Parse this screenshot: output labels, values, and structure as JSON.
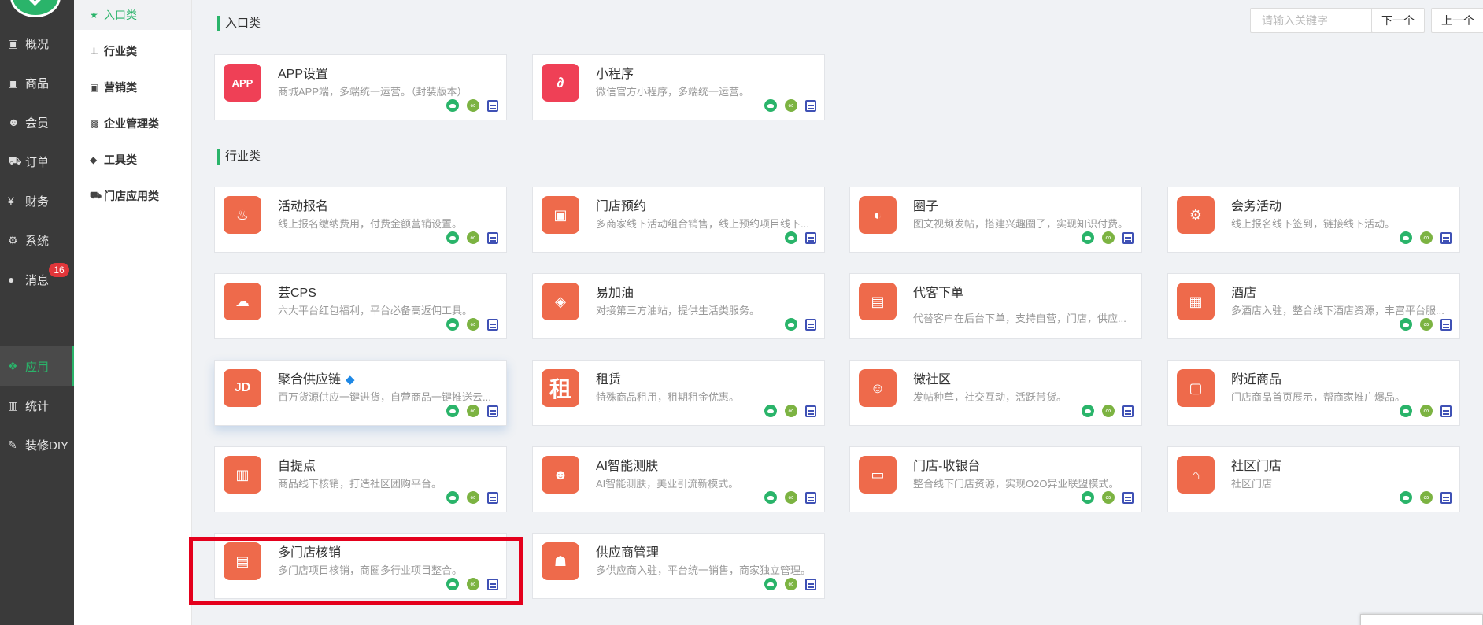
{
  "nav": {
    "items": [
      {
        "label": "概况",
        "icon": "box-icon"
      },
      {
        "label": "商品",
        "icon": "box-icon"
      },
      {
        "label": "会员",
        "icon": "users-icon"
      },
      {
        "label": "订单",
        "icon": "cart-icon"
      },
      {
        "label": "财务",
        "icon": "yen-icon"
      },
      {
        "label": "系统",
        "icon": "gears-icon"
      },
      {
        "label": "消息",
        "icon": "chat-icon",
        "badge": "16"
      },
      {
        "label": "应用",
        "icon": "cubes-icon",
        "active": true
      },
      {
        "label": "统计",
        "icon": "bar-chart-icon"
      },
      {
        "label": "装修DIY",
        "icon": "wrench-icon"
      }
    ]
  },
  "categories": [
    {
      "label": "入口类",
      "icon": "star-icon",
      "active": true
    },
    {
      "label": "行业类",
      "icon": "sitemap-icon"
    },
    {
      "label": "营销类",
      "icon": "money-icon"
    },
    {
      "label": "企业管理类",
      "icon": "briefcase-icon"
    },
    {
      "label": "工具类",
      "icon": "tags-icon"
    },
    {
      "label": "门店应用类",
      "icon": "truck-icon"
    }
  ],
  "toolbar": {
    "search_placeholder": "请输入关键字",
    "next_label": "下一个",
    "prev_label": "上一个"
  },
  "sections": {
    "entry": "入口类",
    "industry": "行业类"
  },
  "cards": [
    {
      "name": "APP设置",
      "desc": "商城APP端，多端统一运营。（封装版本）",
      "glyph": "APP"
    },
    {
      "name": "小程序",
      "desc": "微信官方小程序，多端统一运营。",
      "glyph": "∂"
    },
    {
      "name": "活动报名",
      "desc": "线上报名缴纳费用，付费金额营销设置。",
      "glyph": "♨"
    },
    {
      "name": "门店预约",
      "desc": "多商家线下活动组合销售，线上预约项目线下...",
      "glyph": "▣"
    },
    {
      "name": "圈子",
      "desc": "图文视频发帖，搭建兴趣圈子，实现知识付费。",
      "glyph": "◐"
    },
    {
      "name": "会务活动",
      "desc": "线上报名线下签到，链接线下活动。",
      "glyph": "⚙"
    },
    {
      "name": "芸CPS",
      "desc": "六大平台红包福利，平台必备高返佣工具。",
      "glyph": "☁"
    },
    {
      "name": "易加油",
      "desc": "对接第三方油站，提供生活类服务。",
      "glyph": "◈"
    },
    {
      "name": "代客下单",
      "desc": "代替客户在后台下单，支持自营，门店，供应...",
      "glyph": "▤"
    },
    {
      "name": "酒店",
      "desc": "多酒店入驻，整合线下酒店资源，丰富平台服...",
      "glyph": "▦"
    },
    {
      "name": "聚合供应链",
      "desc": "百万货源供应一键进货，自营商品一键推送云...",
      "glyph": "JD",
      "tag": "◆"
    },
    {
      "name": "租赁",
      "desc": "特殊商品租用，租期租金优惠。",
      "glyph": "租"
    },
    {
      "name": "微社区",
      "desc": "发帖种草，社交互动，活跃带货。",
      "glyph": "☺"
    },
    {
      "name": "附近商品",
      "desc": "门店商品首页展示，帮商家推广爆品。",
      "glyph": "▢"
    },
    {
      "name": "自提点",
      "desc": "商品线下核销，打造社区团购平台。",
      "glyph": "▥"
    },
    {
      "name": "AI智能测肤",
      "desc": "AI智能测肤，美业引流新模式。",
      "glyph": "☻"
    },
    {
      "name": "门店-收银台",
      "desc": "整合线下门店资源，实现O2O异业联盟模式。",
      "glyph": "▭"
    },
    {
      "name": "社区门店",
      "desc": "社区门店",
      "glyph": "⌂"
    },
    {
      "name": "多门店核销",
      "desc": "多门店项目核销，商圈多行业项目整合。",
      "glyph": "▤"
    },
    {
      "name": "供应商管理",
      "desc": "多供应商入驻，平台统一销售，商家独立管理。",
      "glyph": "☗"
    }
  ]
}
